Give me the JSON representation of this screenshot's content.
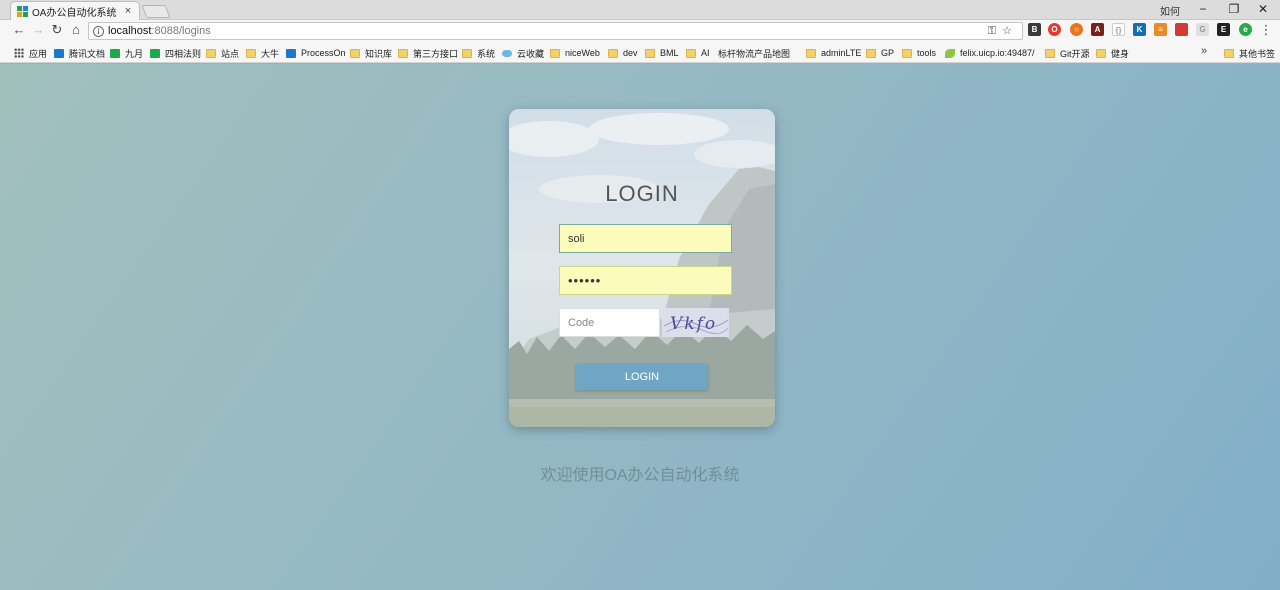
{
  "browser": {
    "tab_title": "OA办公自动化系统",
    "tab_close": "×",
    "window_user": "如何",
    "win_min": "−",
    "win_restore": "❐",
    "win_close": "✕",
    "url_host": "localhost",
    "url_path": ":8088/logins"
  },
  "bookmarks": [
    {
      "label": "应用",
      "icon": "apps-icon"
    },
    {
      "label": "腾讯文档",
      "icon": "bookmark-icon"
    },
    {
      "label": "九月",
      "icon": "bookmark-icon"
    },
    {
      "label": "四相法则",
      "icon": "bookmark-icon"
    },
    {
      "label": "站点",
      "icon": "folder-icon"
    },
    {
      "label": "大牛",
      "icon": "folder-icon"
    },
    {
      "label": "ProcessOn",
      "icon": "bookmark-icon"
    },
    {
      "label": "知识库",
      "icon": "folder-icon"
    },
    {
      "label": "第三方接口",
      "icon": "folder-icon"
    },
    {
      "label": "系统",
      "icon": "folder-icon"
    },
    {
      "label": "云收藏",
      "icon": "cloud-icon"
    },
    {
      "label": "niceWeb",
      "icon": "folder-icon"
    },
    {
      "label": "dev",
      "icon": "folder-icon"
    },
    {
      "label": "BML",
      "icon": "folder-icon"
    },
    {
      "label": "AI",
      "icon": "folder-icon"
    },
    {
      "label": "标杆物流产品地图",
      "icon": "page-icon"
    },
    {
      "label": "adminLTE",
      "icon": "folder-icon"
    },
    {
      "label": "GP",
      "icon": "folder-icon"
    },
    {
      "label": "tools",
      "icon": "folder-icon"
    },
    {
      "label": "felix.uicp.io:49487/",
      "icon": "leaf-icon"
    },
    {
      "label": "Git开源",
      "icon": "folder-icon"
    },
    {
      "label": "健身",
      "icon": "folder-icon"
    },
    {
      "label": "其他书签",
      "icon": "folder-icon"
    }
  ],
  "bookmarks_more": "»",
  "login": {
    "title": "LOGIN",
    "username_value": "soli",
    "password_value": "••••••",
    "code_placeholder": "Code",
    "captcha_text": "Vkfo",
    "button_label": "LOGIN"
  },
  "welcome": "欢迎使用OA办公自动化系统",
  "colors": {
    "accent_button": "#6fa6c5",
    "autofill_field": "#fbfcbc"
  }
}
